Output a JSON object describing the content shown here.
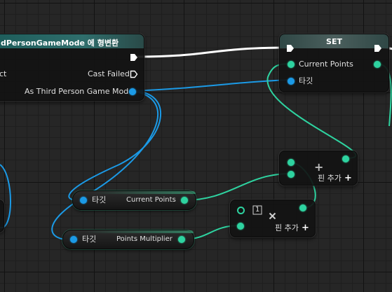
{
  "cast_node": {
    "title": "dPersonGameMode 에 형변환",
    "object_label": "ct",
    "cast_failed_label": "Cast Failed",
    "output_label": "As Third Person Game Mode",
    "header_color": "#2a6b6a"
  },
  "set_node": {
    "title": "SET",
    "current_points_label": "Current Points",
    "target_label": "타깃",
    "header_color": "#3b4a48"
  },
  "add_node": {
    "add_pin_label": "핀 추가"
  },
  "multiply_node": {
    "index_label": "1",
    "add_pin_label": "핀 추가"
  },
  "var_current_points": {
    "target_label": "타깃",
    "name": "Current Points"
  },
  "var_points_multiplier": {
    "target_label": "타깃",
    "name": "Points Multiplier"
  },
  "colors": {
    "object_wire": "#1b9ae6",
    "float_wire": "#2ed3a0",
    "exec_wire": "#ffffff"
  }
}
